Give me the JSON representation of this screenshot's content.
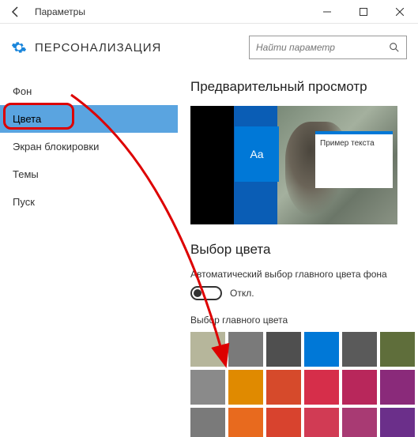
{
  "window": {
    "title": "Параметры"
  },
  "header": {
    "page_title": "ПЕРСОНАЛИЗАЦИЯ",
    "search_placeholder": "Найти параметр"
  },
  "sidebar": {
    "items": [
      {
        "label": "Фон"
      },
      {
        "label": "Цвета"
      },
      {
        "label": "Экран блокировки"
      },
      {
        "label": "Темы"
      },
      {
        "label": "Пуск"
      }
    ],
    "active_index": 1
  },
  "content": {
    "preview_heading": "Предварительный просмотр",
    "preview_sample_text": "Пример текста",
    "preview_aa": "Aa",
    "color_heading": "Выбор цвета",
    "auto_color_label": "Автоматический выбор главного цвета фона",
    "toggle_state_label": "Откл.",
    "accent_label": "Выбор главного цвета",
    "swatches": [
      "#b6b69b",
      "#7a7a7a",
      "#4f4f4f",
      "#0078d7",
      "#5a5a5a",
      "#5f6e3b",
      "#8a8a8a",
      "#e08a00",
      "#d64a2b",
      "#d62e4a",
      "#b8275b",
      "#8a2a7a",
      "#7a7a7a",
      "#e86a1e",
      "#d8432e",
      "#d13b54",
      "#a83a73",
      "#6b2f8a"
    ]
  }
}
